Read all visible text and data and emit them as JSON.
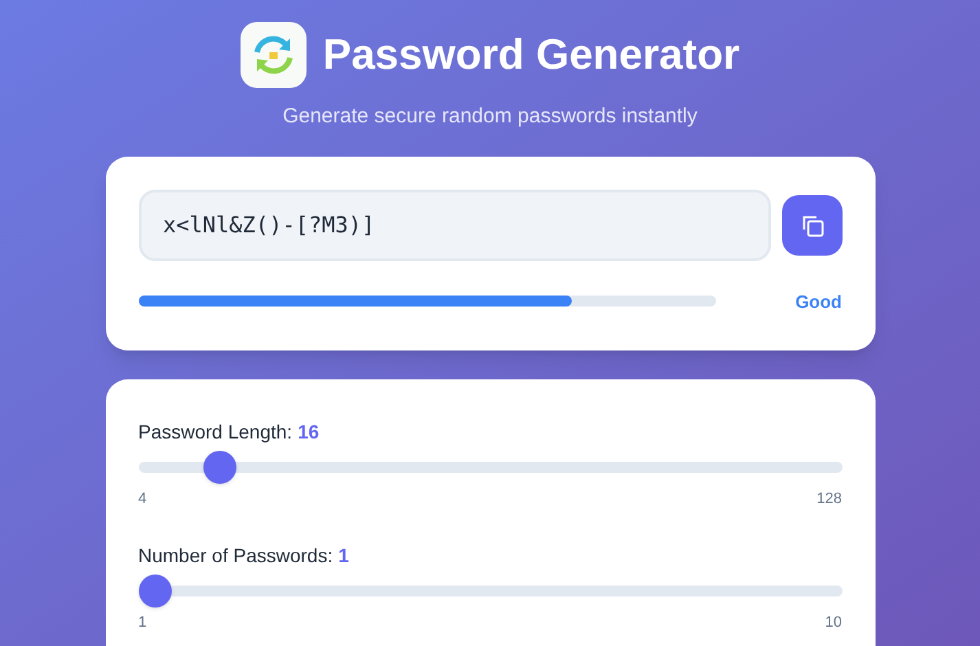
{
  "header": {
    "title": "Password Generator",
    "subtitle": "Generate secure random passwords instantly"
  },
  "output": {
    "value": "x<lNl&Z()-[?M3)]",
    "strength": {
      "level": 0.75,
      "label": "Good"
    }
  },
  "sliders": [
    {
      "label": "Password Length:",
      "value": "16",
      "level": 0.097,
      "min": "4",
      "max": "128"
    },
    {
      "label": "Number of Passwords:",
      "value": "1",
      "level": 0,
      "min": "1",
      "max": "10"
    }
  ]
}
